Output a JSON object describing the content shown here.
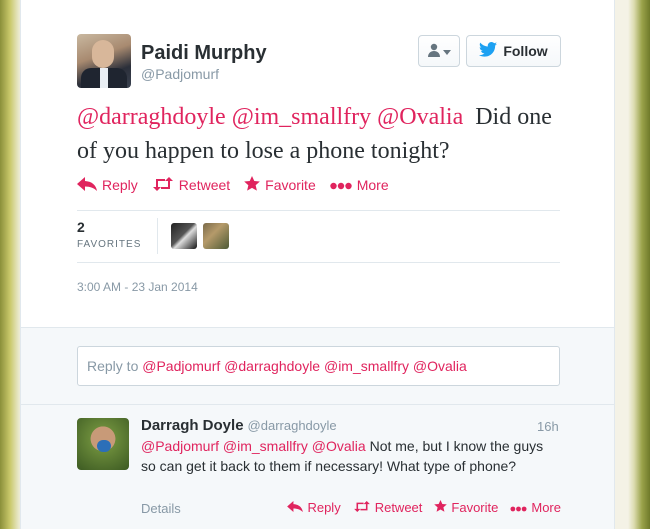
{
  "tweet": {
    "author_name": "Paidi Murphy",
    "author_handle": "@Padjomurf",
    "follow_label": "Follow",
    "mentions": [
      "@darraghdoyle",
      "@im_smallfry",
      "@Ovalia"
    ],
    "text": "Did one of you happen to lose a phone tonight?",
    "actions": {
      "reply": "Reply",
      "retweet": "Retweet",
      "favorite": "Favorite",
      "more": "More"
    },
    "favorites_count": "2",
    "favorites_label": "FAVORITES",
    "timestamp": "3:00 AM - 23 Jan 2014"
  },
  "reply_box": {
    "prefix": "Reply to",
    "mentions": "@Padjomurf @darraghdoyle @im_smallfry @Ovalia"
  },
  "reply_tweet": {
    "author_name": "Darragh Doyle",
    "author_handle": "@darraghdoyle",
    "time": "16h",
    "mentions": "@Padjomurf @im_smallfry @Ovalia",
    "text": "Not me, but I know the guys so can get it back to them if necessary! What type of phone?",
    "details_label": "Details",
    "actions": {
      "reply": "Reply",
      "retweet": "Retweet",
      "favorite": "Favorite",
      "more": "More"
    }
  },
  "colors": {
    "accent": "#e0245e",
    "twitter_blue": "#1da1f2",
    "muted": "#8899a6"
  },
  "icons": [
    "user-icon",
    "chevron-down-icon",
    "twitter-bird-icon",
    "reply-icon",
    "retweet-icon",
    "star-icon",
    "more-dots-icon"
  ]
}
